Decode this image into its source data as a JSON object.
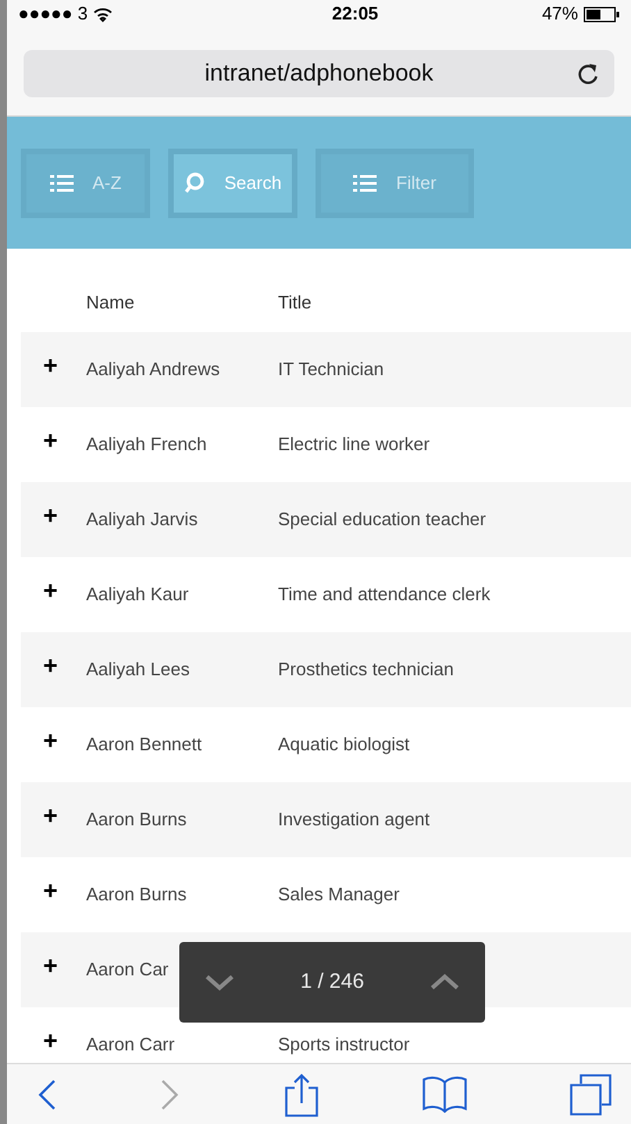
{
  "status_bar": {
    "carrier": "●●●●● 3",
    "time": "22:05",
    "battery": "47%"
  },
  "address_bar": {
    "url": "intranet/adphonebook"
  },
  "toolbar": [
    {
      "kind": "list",
      "label": "A-Z",
      "selected": false
    },
    {
      "kind": "search",
      "label": "Search",
      "selected": true
    },
    {
      "kind": "list",
      "label": "Filter",
      "selected": false
    }
  ],
  "table": {
    "columns": [
      "Name",
      "Title"
    ],
    "rows": [
      {
        "expand": "+",
        "name": "Aaliyah Andrews",
        "title": "IT Technician"
      },
      {
        "expand": "+",
        "name": "Aaliyah French",
        "title": "Electric line worker"
      },
      {
        "expand": "+",
        "name": "Aaliyah Jarvis",
        "title": "Special education teacher"
      },
      {
        "expand": "+",
        "name": "Aaliyah Kaur",
        "title": "Time and attendance clerk"
      },
      {
        "expand": "+",
        "name": "Aaliyah Lees",
        "title": "Prosthetics technician"
      },
      {
        "expand": "+",
        "name": "Aaron Bennett",
        "title": "Aquatic biologist"
      },
      {
        "expand": "+",
        "name": "Aaron Burns",
        "title": "Investigation agent"
      },
      {
        "expand": "+",
        "name": "Aaron Burns",
        "title": "Sales Manager"
      },
      {
        "expand": "+",
        "name": "Aaron Car"
      },
      {
        "expand": "+",
        "name": "Aaron Carr",
        "title": "Sports instructor"
      }
    ]
  },
  "find_overlay": {
    "counter": "1 / 246"
  }
}
